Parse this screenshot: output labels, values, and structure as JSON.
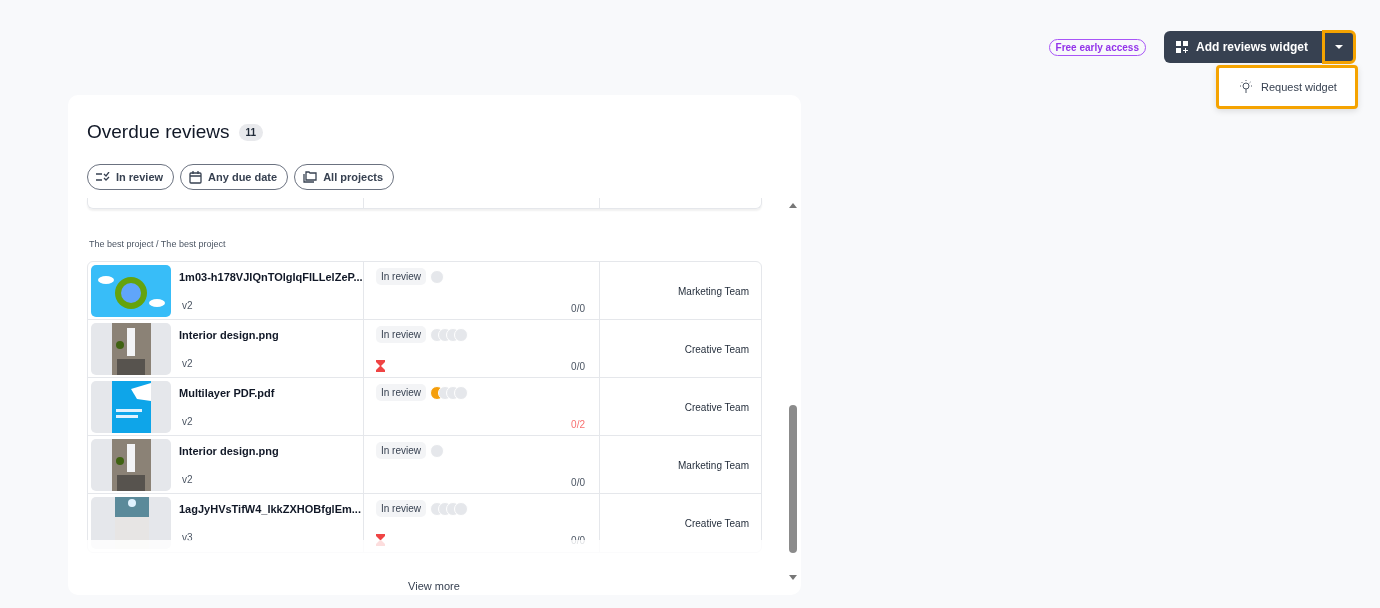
{
  "header": {
    "badge": "Free early access",
    "add_button": "Add reviews widget",
    "dropdown": {
      "expanded": true,
      "items": [
        "Request widget"
      ]
    }
  },
  "widget": {
    "title": "Overdue reviews",
    "count": "11",
    "filters": [
      {
        "kind": "status",
        "label": "In review"
      },
      {
        "kind": "date",
        "label": "Any due date"
      },
      {
        "kind": "project",
        "label": "All projects"
      }
    ],
    "group": "The best project / The best project",
    "rows": [
      {
        "name": "1m03-h178VJIQnTOlgIqFlLLelZeP...",
        "version": "v2",
        "status": "In review",
        "avatars": [
          {
            "color": "#e5e7eb"
          }
        ],
        "overdue": false,
        "progress": "0/0",
        "progress_alert": false,
        "team": "Marketing Team"
      },
      {
        "name": "Interior design.png",
        "version": "v2",
        "status": "In review",
        "avatars": [
          {
            "color": "#e5e7eb"
          },
          {
            "color": "#e5e7eb"
          },
          {
            "color": "#e5e7eb"
          },
          {
            "color": "#e5e7eb"
          }
        ],
        "overdue": true,
        "progress": "0/0",
        "progress_alert": false,
        "team": "Creative Team"
      },
      {
        "name": "Multilayer PDF.pdf",
        "version": "v2",
        "status": "In review",
        "avatars": [
          {
            "color": "#f59e0b"
          },
          {
            "color": "#e5e7eb"
          },
          {
            "color": "#e5e7eb"
          },
          {
            "color": "#e5e7eb"
          }
        ],
        "overdue": false,
        "progress": "0/2",
        "progress_alert": true,
        "team": "Creative Team"
      },
      {
        "name": "Interior design.png",
        "version": "v2",
        "status": "In review",
        "avatars": [
          {
            "color": "#e5e7eb"
          }
        ],
        "overdue": false,
        "progress": "0/0",
        "progress_alert": false,
        "team": "Marketing Team"
      },
      {
        "name": "1agJyHVsTifW4_lkkZXHOBfglEm...",
        "version": "v3",
        "status": "In review",
        "avatars": [
          {
            "color": "#e5e7eb"
          },
          {
            "color": "#e5e7eb"
          },
          {
            "color": "#e5e7eb"
          },
          {
            "color": "#e5e7eb"
          }
        ],
        "overdue": true,
        "progress": "0/0",
        "progress_alert": false,
        "team": "Creative Team"
      }
    ],
    "footer": "View more"
  }
}
